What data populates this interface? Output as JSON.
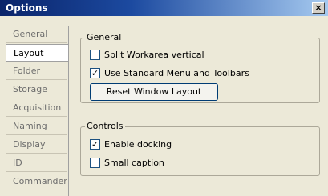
{
  "window": {
    "title": "Options",
    "close_symbol": "×"
  },
  "sidebar": {
    "items": [
      {
        "label": "General"
      },
      {
        "label": "Layout"
      },
      {
        "label": "Folder"
      },
      {
        "label": "Storage"
      },
      {
        "label": "Acquisition"
      },
      {
        "label": "Naming"
      },
      {
        "label": "Display"
      },
      {
        "label": "ID"
      },
      {
        "label": "Commander"
      }
    ],
    "selected": "Layout"
  },
  "general_group": {
    "title": "General",
    "split_workarea": {
      "label": "Split Workarea vertical",
      "checked": false,
      "mark": ""
    },
    "standard_menu": {
      "label": "Use Standard Menu and Toolbars",
      "checked": true,
      "mark": "✓"
    },
    "reset_button": "Reset Window Layout"
  },
  "controls_group": {
    "title": "Controls",
    "enable_docking": {
      "label": "Enable docking",
      "checked": true,
      "mark": "✓"
    },
    "small_caption": {
      "label": "Small caption",
      "checked": false,
      "mark": ""
    }
  },
  "colors": {
    "titlebar_start": "#0a246a",
    "titlebar_end": "#a6caf0",
    "dialog_bg": "#ece9d8",
    "selected_tab_bg": "#ffffff"
  }
}
